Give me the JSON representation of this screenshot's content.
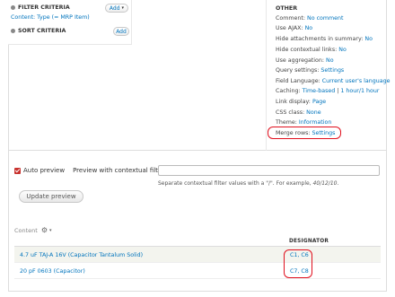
{
  "filter_criteria": {
    "title": "FILTER CRITERIA",
    "add_label": "Add",
    "item": "Content: Type (= MRP Item)"
  },
  "sort_criteria": {
    "title": "SORT CRITERIA",
    "add_label": "Add"
  },
  "other": {
    "title": "OTHER",
    "options": [
      {
        "label": "Comment:",
        "value": "No comment"
      },
      {
        "label": "Use AJAX:",
        "value": "No"
      },
      {
        "label": "Hide attachments in summary:",
        "value": "No"
      },
      {
        "label": "Hide contextual links:",
        "value": "No"
      },
      {
        "label": "Use aggregation:",
        "value": "No"
      },
      {
        "label": "Query settings:",
        "value": "Settings"
      },
      {
        "label": "Field Language:",
        "value": "Current user's language"
      },
      {
        "label": "Caching:",
        "value": "Time-based",
        "value2": "1 hour/1 hour"
      },
      {
        "label": "Link display:",
        "value": "Page"
      },
      {
        "label": "CSS class:",
        "value": "None"
      },
      {
        "label": "Theme:",
        "value": "Information"
      },
      {
        "label": "Merge rows:",
        "value": "Settings"
      }
    ]
  },
  "preview": {
    "auto_preview_label": "Auto preview",
    "auto_preview_checked": true,
    "contextual_label": "Preview with contextual filters:",
    "contextual_value": "",
    "help_prefix": "Separate contextual filter values with a \"/\". For example, ",
    "help_example": "40/12/10",
    "help_suffix": ".",
    "update_label": "Update preview"
  },
  "content": {
    "label": "Content",
    "columns": [
      "",
      "DESIGNATOR"
    ],
    "rows": [
      {
        "title": "4.7 uF TAJ-A 16V (Capacitor Tantalum Solid)",
        "designator": "C1, C6"
      },
      {
        "title": "20 pF 0603 (Capacitor)",
        "designator": "C7, C8"
      }
    ]
  },
  "colors": {
    "link": "#0074bd",
    "highlight": "#e0101e",
    "checkbox": "#c8322e"
  }
}
